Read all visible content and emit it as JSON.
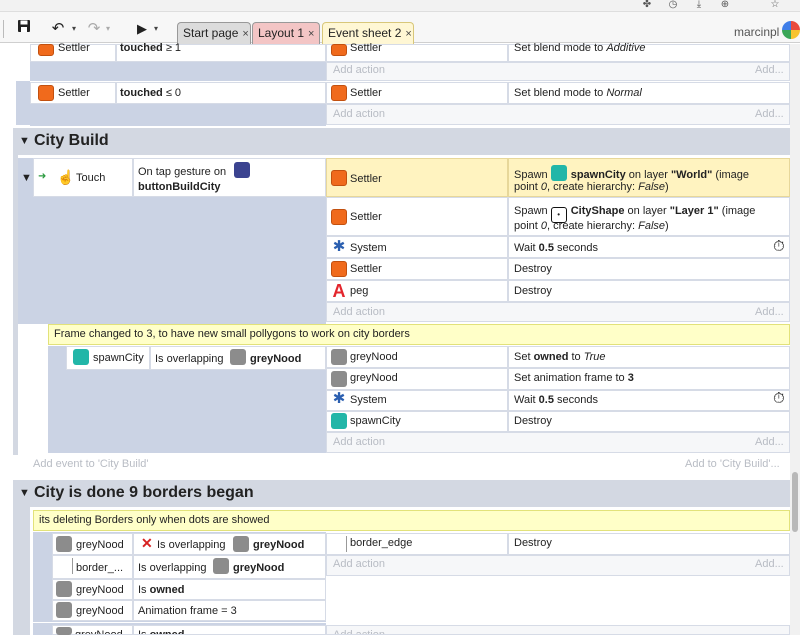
{
  "browser_icons": [
    "puzzle-icon",
    "history-icon",
    "download-icon",
    "zoom-icon",
    "bookmark-icon"
  ],
  "toolbar": {
    "undo_glyph": "↶",
    "redo_glyph": "↷",
    "run_glyph": "▶",
    "dropdown_glyph": "▾"
  },
  "tabs": [
    {
      "label": "Start page",
      "close": "×"
    },
    {
      "label": "Layout 1",
      "close": "×"
    },
    {
      "label": "Event sheet 2",
      "close": "×"
    }
  ],
  "user": {
    "name": "marcinpl"
  },
  "add_action": "Add action",
  "add_more": "Add...",
  "top_events": [
    {
      "object": "Settler",
      "condition_prefix": "",
      "condition_bold": "touched",
      "condition_suffix": " ≥ 1",
      "act_object": "Settler",
      "act_text": "Set blend mode to ",
      "act_italic": "Additive"
    },
    {
      "object": "Settler",
      "condition_prefix": "",
      "condition_bold": "touched",
      "condition_suffix": " ≤ 0",
      "act_object": "Settler",
      "act_text": "Set blend mode to ",
      "act_italic": "Normal"
    }
  ],
  "group_city_build": {
    "collapse_glyph": "▼",
    "title": "City Build",
    "trigger": {
      "expand_glyph": "▼",
      "arrow_glyph": "➜",
      "hand_glyph": "☝",
      "object": "Touch",
      "cond_line1": "On tap gesture on",
      "cond_line2": "buttonBuildCity"
    },
    "actions": [
      {
        "object": "Settler",
        "icon": "settler",
        "line1_pre": "Spawn ",
        "line1_bold": "spawnCity",
        "line1_mid": " on layer ",
        "line1_bold2": "\"World\"",
        "line1_post": " (image",
        "line2_pre": "point ",
        "line2_it": "0",
        "line2_mid": ", create hierarchy: ",
        "line2_it2": "False",
        "line2_post": ")"
      },
      {
        "object": "Settler",
        "icon": "settler",
        "line1_pre": "Spawn ",
        "line1_bold": "CityShape",
        "line1_mid": " on layer ",
        "line1_bold2": "\"Layer 1\"",
        "line1_post": " (image",
        "line2_pre": "point ",
        "line2_it": "0",
        "line2_mid": ", create hierarchy: ",
        "line2_it2": "False",
        "line2_post": ")"
      },
      {
        "object": "System",
        "icon": "system",
        "text_pre": "Wait ",
        "text_bold": "0.5",
        "text_post": " seconds"
      },
      {
        "object": "Settler",
        "icon": "settler",
        "text": "Destroy"
      },
      {
        "object": "peg",
        "icon": "peg",
        "text": "Destroy"
      }
    ],
    "comment": "Frame changed to 3, to have new small pollygons to work on city borders",
    "sub_event": {
      "object": "spawnCity",
      "cond_pre": "Is overlapping",
      "cond_bold": "greyNood",
      "actions": [
        {
          "object": "greyNood",
          "text_pre": "Set ",
          "text_bold": "owned",
          "text_mid": " to ",
          "text_it": "True"
        },
        {
          "object": "greyNood",
          "text_pre": "Set animation frame to ",
          "text_bold": "3"
        },
        {
          "object": "System",
          "text_pre": "Wait ",
          "text_bold": "0.5",
          "text_post": " seconds"
        },
        {
          "object": "spawnCity",
          "text": "Destroy"
        }
      ]
    },
    "add_event": "Add event to 'City Build'",
    "add_to": "Add to 'City Build'..."
  },
  "group_city_done": {
    "collapse_glyph": "▼",
    "title": "City is done 9 borders began",
    "comment": "its deleting Borders only when dots are showed",
    "conditions": [
      {
        "object": "greyNood",
        "neg": "✕",
        "pre": "Is overlapping",
        "bold": "greyNood"
      },
      {
        "object": "border_...",
        "pre": "Is overlapping",
        "bold": "greyNood"
      },
      {
        "object": "greyNood",
        "pre": "Is ",
        "bold": "owned"
      },
      {
        "object": "greyNood",
        "pre": "Animation frame = 3"
      }
    ],
    "action": {
      "object": "border_edge",
      "text": "Destroy"
    },
    "next_row": {
      "object": "greyNood",
      "pre": "Is ",
      "bold": "owned"
    }
  },
  "timer_glyph": "⏱",
  "system_glyph": "✱",
  "peg_glyph": "A"
}
